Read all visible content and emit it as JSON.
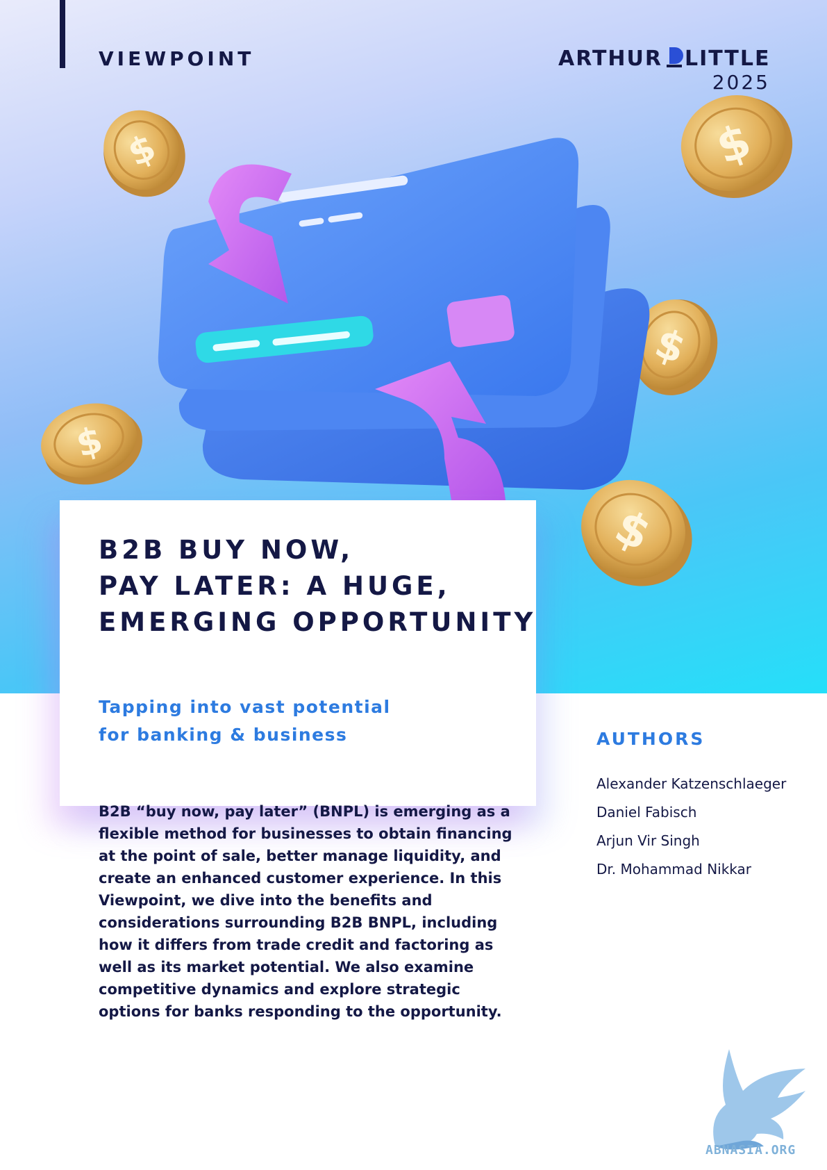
{
  "header": {
    "label": "VIEWPOINT",
    "logo_text": "ARTHUR D LITTLE",
    "logo_aria": "Arthur D. Little logo",
    "year": "2025"
  },
  "illustration": {
    "items": [
      "coin-icon",
      "credit-card-icon",
      "arrow-icon"
    ],
    "colors": {
      "card": "#4f88f0",
      "arrow": "#cf6ef2",
      "coin": "#e0ae56",
      "stripe": "#2fd9e6"
    }
  },
  "title": {
    "lines": [
      "B2B BUY NOW,",
      "PAY LATER: A HUGE,",
      "EMERGING OPPORTUNITY"
    ]
  },
  "subtitle": {
    "lines": [
      "Tapping into vast potential",
      "for banking & business"
    ]
  },
  "body": {
    "text": "B2B “buy now, pay later” (BNPL) is emerging as a flexible method for businesses to obtain financing at the point of sale, better manage liquidity, and create an enhanced customer experience. In this Viewpoint, we dive into the benefits and considerations surrounding B2B BNPL, including how it differs from trade credit and factoring as well as its market potential. We also examine competitive dynamics and explore strategic options for banks responding to the opportunity."
  },
  "authors": {
    "heading": "AUTHORS",
    "names": [
      "Alexander Katzenschlaeger",
      "Daniel Fabisch",
      "Arjun Vir Singh",
      "Dr. Mohammad Nikkar"
    ]
  },
  "watermark": {
    "text": "ABNASIA.ORG",
    "icon": "griffin-icon"
  }
}
